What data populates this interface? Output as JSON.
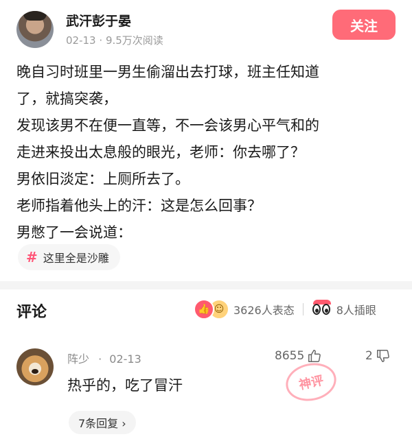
{
  "post": {
    "author": "武汗彭于晏",
    "date": "02-13",
    "meta_sep": "·",
    "views": "9.5万次阅读",
    "follow_label": "关注",
    "lines": [
      "晚自习时班里一男生偷溜出去打球，班主任知道",
      "了，就搞突袭，",
      "发现该男不在便一直等，不一会该男心平气和的",
      "走进来投出太息般的眼光，老师：你去哪了？",
      "男依旧淡定：上厕所去了。",
      "老师指着他头上的汗：这是怎么回事？",
      "男憋了一会说道："
    ],
    "topic_tag": "这里全是沙雕"
  },
  "comments": {
    "title": "评论",
    "reactions_text": "3626人表态",
    "eyes_text": "8人插眼"
  },
  "comment": {
    "user": "阵少",
    "date": "02-13",
    "likes": "8655",
    "dislikes": "2",
    "text": "热乎的，吃了冒汗",
    "stamp_text": "神评",
    "replies_label": "7条回复 ›"
  },
  "colors": {
    "accent": "#ff6b78"
  },
  "icons": [
    "hash-icon",
    "like-reaction-icon",
    "smile-reaction-icon",
    "eyes-icon",
    "thumb-up-icon",
    "thumb-down-icon"
  ]
}
